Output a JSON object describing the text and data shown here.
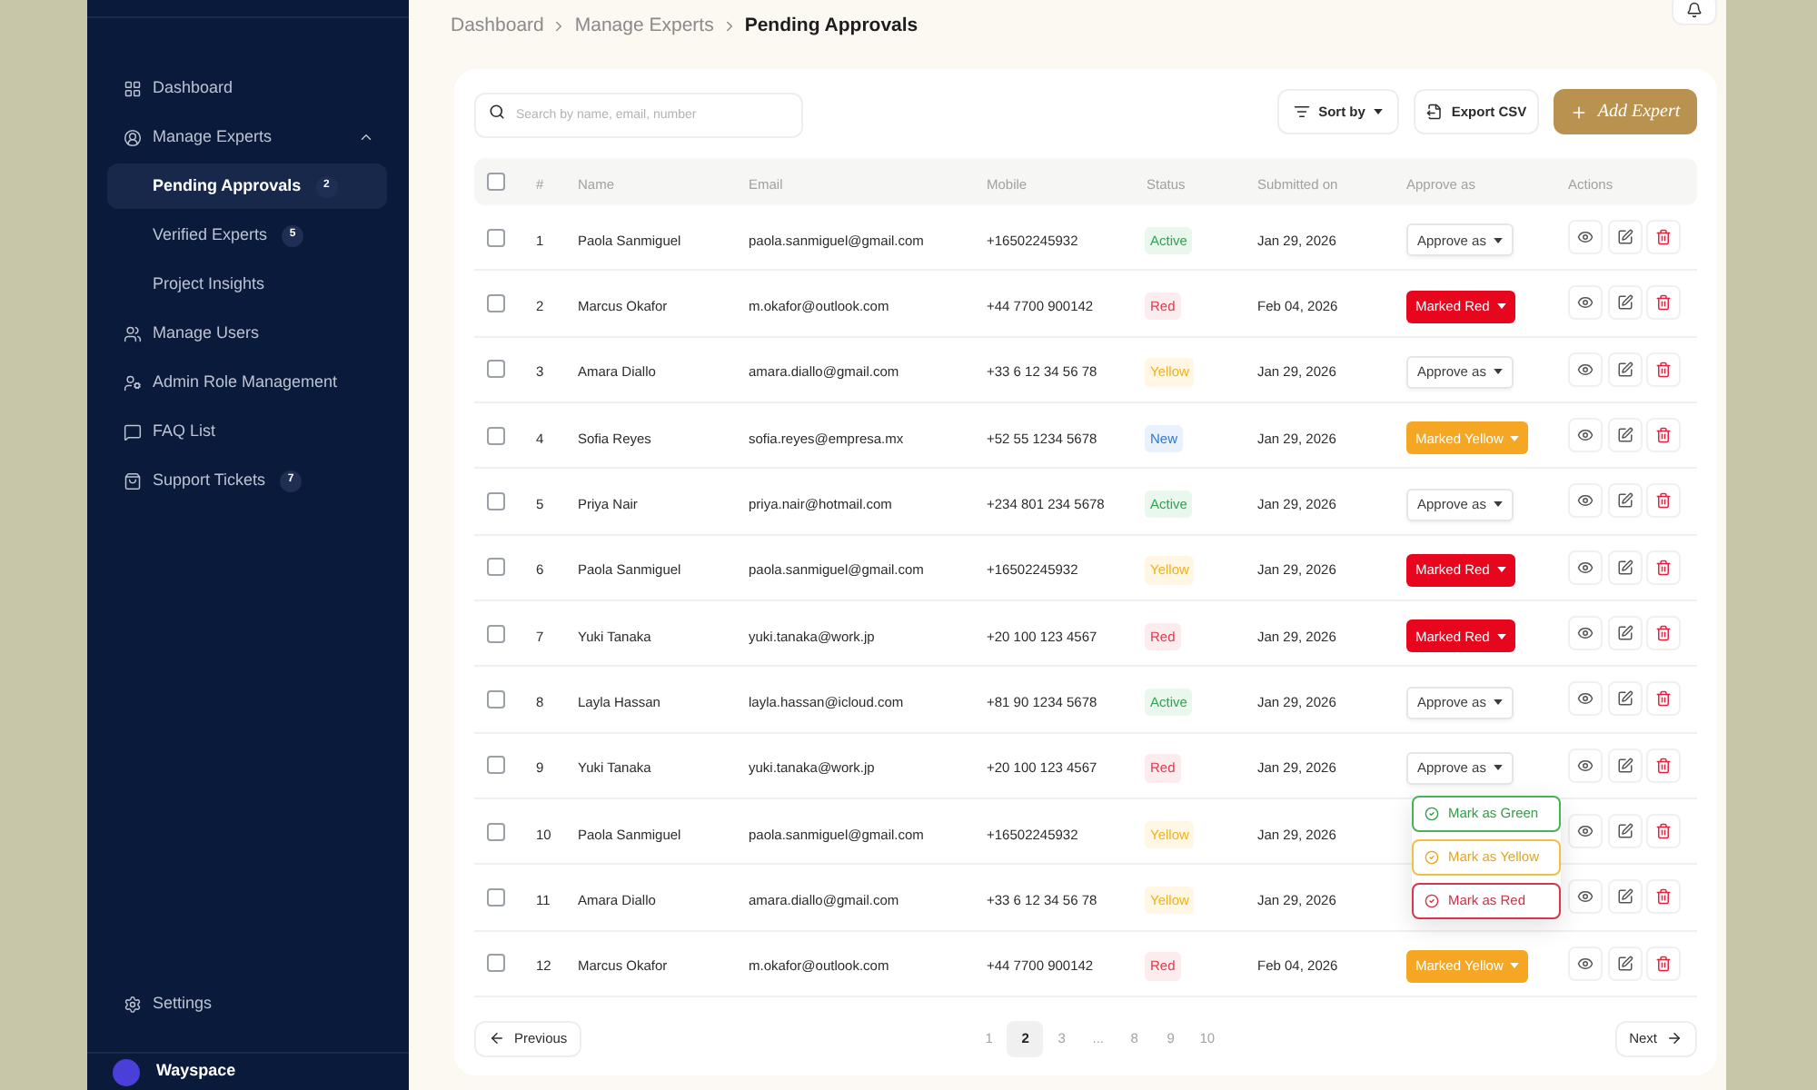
{
  "breadcrumb": [
    {
      "label": "Dashboard",
      "current": false
    },
    {
      "label": "Manage Experts",
      "current": false
    },
    {
      "label": "Pending Approvals",
      "current": true
    }
  ],
  "sidebar": {
    "items": [
      {
        "label": "Dashboard",
        "selected": false
      },
      {
        "label": "Manage Experts",
        "selected": false,
        "expanded": true,
        "children": [
          {
            "label": "Pending Approvals",
            "selected": true,
            "badge": "2"
          },
          {
            "label": "Verified Experts",
            "selected": false,
            "badge": "5"
          },
          {
            "label": "Project Insights",
            "selected": false
          }
        ]
      },
      {
        "label": "Manage Users",
        "selected": false
      },
      {
        "label": "Admin Role Management",
        "selected": false
      },
      {
        "label": "FAQ List",
        "selected": false
      },
      {
        "label": "Support Tickets",
        "selected": false,
        "badge": "7"
      }
    ],
    "settings": {
      "label": "Settings"
    },
    "user": {
      "name": "Wayspace"
    }
  },
  "toolbar": {
    "search": {
      "placeholder": "Search by name, email, number"
    },
    "sort": {
      "label": "Sort by"
    },
    "export": {
      "label": "Export CSV"
    },
    "add": {
      "label": "Add Expert"
    }
  },
  "table": {
    "header_checkbox": {
      "checked": false
    },
    "columns": [
      "#",
      "Name",
      "Email",
      "Mobile",
      "Status",
      "Submitted on",
      "Approve as",
      "Actions"
    ],
    "rows": [
      {
        "checked": false,
        "number": "1",
        "name": "Paola Sanmiguel",
        "email": "paola.sanmiguel@gmail.com",
        "mobile": "+16502245932",
        "status": {
          "label": "Active",
          "kind": "active"
        },
        "submitted": "Jan 29, 2026",
        "approve": {
          "label": "Approve as",
          "kind": "outline"
        }
      },
      {
        "checked": false,
        "number": "2",
        "name": "Marcus Okafor",
        "email": "m.okafor@outlook.com",
        "mobile": "+44 7700 900142",
        "status": {
          "label": "Red",
          "kind": "red"
        },
        "submitted": "Feb 04, 2026",
        "approve": {
          "label": "Marked Red",
          "kind": "red"
        }
      },
      {
        "checked": false,
        "number": "3",
        "name": "Amara Diallo",
        "email": "amara.diallo@gmail.com",
        "mobile": "+33 6 12 34 56 78",
        "status": {
          "label": "Yellow",
          "kind": "yellow"
        },
        "submitted": "Jan 29, 2026",
        "approve": {
          "label": "Approve as",
          "kind": "outline"
        }
      },
      {
        "checked": false,
        "number": "4",
        "name": "Sofia Reyes",
        "email": "sofia.reyes@empresa.mx",
        "mobile": "+52 55 1234 5678",
        "status": {
          "label": "New",
          "kind": "new"
        },
        "submitted": "Jan 29, 2026",
        "approve": {
          "label": "Marked Yellow",
          "kind": "yellow"
        }
      },
      {
        "checked": false,
        "number": "5",
        "name": "Priya Nair",
        "email": "priya.nair@hotmail.com",
        "mobile": "+234 801 234 5678",
        "status": {
          "label": "Active",
          "kind": "active"
        },
        "submitted": "Jan 29, 2026",
        "approve": {
          "label": "Approve as",
          "kind": "outline"
        }
      },
      {
        "checked": false,
        "number": "6",
        "name": "Paola Sanmiguel",
        "email": "paola.sanmiguel@gmail.com",
        "mobile": "+16502245932",
        "status": {
          "label": "Yellow",
          "kind": "yellow"
        },
        "submitted": "Jan 29, 2026",
        "approve": {
          "label": "Marked Red",
          "kind": "red"
        }
      },
      {
        "checked": false,
        "number": "7",
        "name": "Yuki Tanaka",
        "email": "yuki.tanaka@work.jp",
        "mobile": "+20 100 123 4567",
        "status": {
          "label": "Red",
          "kind": "red"
        },
        "submitted": "Jan 29, 2026",
        "approve": {
          "label": "Marked Red",
          "kind": "red"
        }
      },
      {
        "checked": false,
        "number": "8",
        "name": "Layla Hassan",
        "email": "layla.hassan@icloud.com",
        "mobile": "+81 90 1234 5678",
        "status": {
          "label": "Active",
          "kind": "active"
        },
        "submitted": "Jan 29, 2026",
        "approve": {
          "label": "Approve as",
          "kind": "outline"
        }
      },
      {
        "checked": false,
        "number": "9",
        "name": "Yuki Tanaka",
        "email": "yuki.tanaka@work.jp",
        "mobile": "+20 100 123 4567",
        "status": {
          "label": "Red",
          "kind": "red"
        },
        "submitted": "Jan 29, 2026",
        "approve": {
          "label": "Approve as",
          "kind": "outline",
          "menu": [
            {
              "label": "Mark as Green",
              "kind": "green"
            },
            {
              "label": "Mark as Yellow",
              "kind": "yellow"
            },
            {
              "label": "Mark as Red",
              "kind": "red"
            }
          ]
        }
      },
      {
        "checked": false,
        "number": "10",
        "name": "Paola Sanmiguel",
        "email": "paola.sanmiguel@gmail.com",
        "mobile": "+16502245932",
        "status": {
          "label": "Yellow",
          "kind": "yellow"
        },
        "submitted": "Jan 29, 2026"
      },
      {
        "checked": false,
        "number": "11",
        "name": "Amara Diallo",
        "email": "amara.diallo@gmail.com",
        "mobile": "+33 6 12 34 56 78",
        "status": {
          "label": "Yellow",
          "kind": "yellow"
        },
        "submitted": "Jan 29, 2026"
      },
      {
        "checked": false,
        "number": "12",
        "name": "Marcus Okafor",
        "email": "m.okafor@outlook.com",
        "mobile": "+44 7700 900142",
        "status": {
          "label": "Red",
          "kind": "red"
        },
        "submitted": "Feb 04, 2026",
        "approve": {
          "label": "Marked Yellow",
          "kind": "yellow"
        }
      }
    ]
  },
  "pagination": {
    "previous": "Previous",
    "next": "Next",
    "pages": [
      {
        "label": "1",
        "selected": false
      },
      {
        "label": "2",
        "selected": true
      },
      {
        "label": "3",
        "selected": false
      },
      {
        "label": "...",
        "selected": false
      },
      {
        "label": "8",
        "selected": false
      },
      {
        "label": "9",
        "selected": false
      },
      {
        "label": "10",
        "selected": false
      }
    ]
  }
}
